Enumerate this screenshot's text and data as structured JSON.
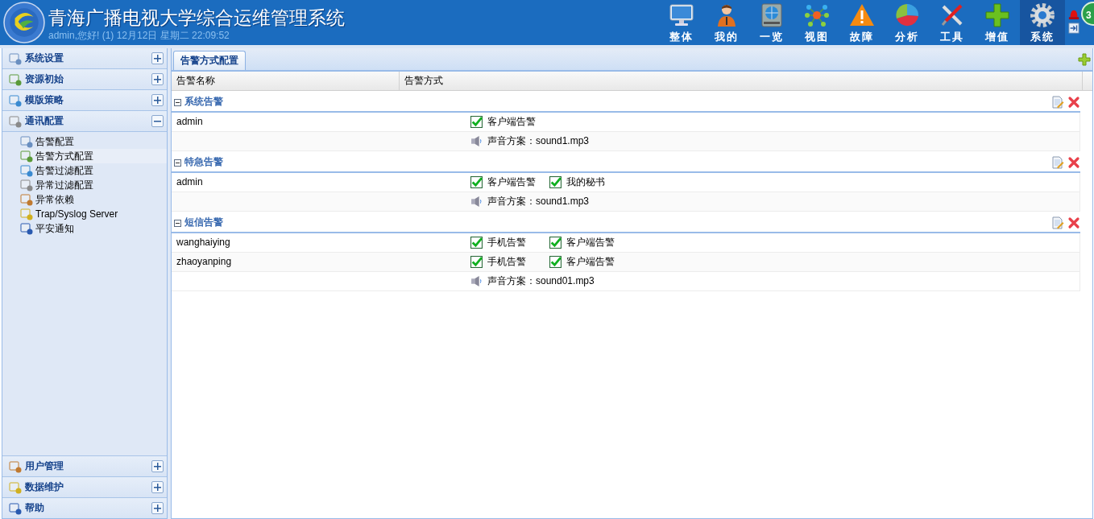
{
  "header": {
    "title": "青海广播电视大学综合运维管理系统",
    "status": "admin,您好! (1) 12月12日 星期二 22:09:52",
    "badge": "3"
  },
  "nav": [
    {
      "label": "整体",
      "selected": false
    },
    {
      "label": "我的",
      "selected": false
    },
    {
      "label": "一览",
      "selected": false
    },
    {
      "label": "视图",
      "selected": false
    },
    {
      "label": "故障",
      "selected": false
    },
    {
      "label": "分析",
      "selected": false
    },
    {
      "label": "工具",
      "selected": false
    },
    {
      "label": "增值",
      "selected": false
    },
    {
      "label": "系统",
      "selected": true
    }
  ],
  "sidebar": {
    "sections": [
      {
        "label": "系统设置",
        "expanded": false
      },
      {
        "label": "资源初始",
        "expanded": false
      },
      {
        "label": "模版策略",
        "expanded": false
      },
      {
        "label": "通讯配置",
        "expanded": true,
        "children": [
          {
            "label": "告警配置",
            "selected": false
          },
          {
            "label": "告警方式配置",
            "selected": true
          },
          {
            "label": "告警过滤配置",
            "selected": false
          },
          {
            "label": "异常过滤配置",
            "selected": false
          },
          {
            "label": "异常依赖",
            "selected": false
          },
          {
            "label": "Trap/Syslog Server",
            "selected": false
          },
          {
            "label": "平安通知",
            "selected": false
          }
        ]
      },
      {
        "label": "用户管理",
        "expanded": false
      },
      {
        "label": "数据维护",
        "expanded": false
      },
      {
        "label": "帮助",
        "expanded": false
      }
    ]
  },
  "tabs": [
    {
      "label": "告警方式配置",
      "selected": true
    }
  ],
  "table": {
    "columns": [
      "告警名称",
      "告警方式"
    ],
    "groups": [
      {
        "name": "系统告警",
        "expanded": true,
        "rows": [
          {
            "name": "admin",
            "items": [
              {
                "kind": "check",
                "label": "客户端告警",
                "checked": true
              }
            ]
          },
          {
            "name": "",
            "items": [
              {
                "kind": "sound",
                "label": "声音方案：sound1.mp3"
              }
            ]
          }
        ]
      },
      {
        "name": "特急告警",
        "expanded": true,
        "rows": [
          {
            "name": "admin",
            "items": [
              {
                "kind": "check",
                "label": "客户端告警",
                "checked": true
              },
              {
                "kind": "check",
                "label": "我的秘书",
                "checked": true
              }
            ]
          },
          {
            "name": "",
            "items": [
              {
                "kind": "sound",
                "label": "声音方案：sound1.mp3"
              }
            ]
          }
        ]
      },
      {
        "name": "短信告警",
        "expanded": true,
        "rows": [
          {
            "name": "wanghaiying",
            "items": [
              {
                "kind": "check",
                "label": "手机告警",
                "checked": true
              },
              {
                "kind": "check",
                "label": "客户端告警",
                "checked": true
              }
            ]
          },
          {
            "name": "zhaoyanping",
            "items": [
              {
                "kind": "check",
                "label": "手机告警",
                "checked": true
              },
              {
                "kind": "check",
                "label": "客户端告警",
                "checked": true
              }
            ]
          },
          {
            "name": "",
            "items": [
              {
                "kind": "sound",
                "label": "声音方案：sound01.mp3"
              }
            ]
          }
        ]
      }
    ]
  }
}
